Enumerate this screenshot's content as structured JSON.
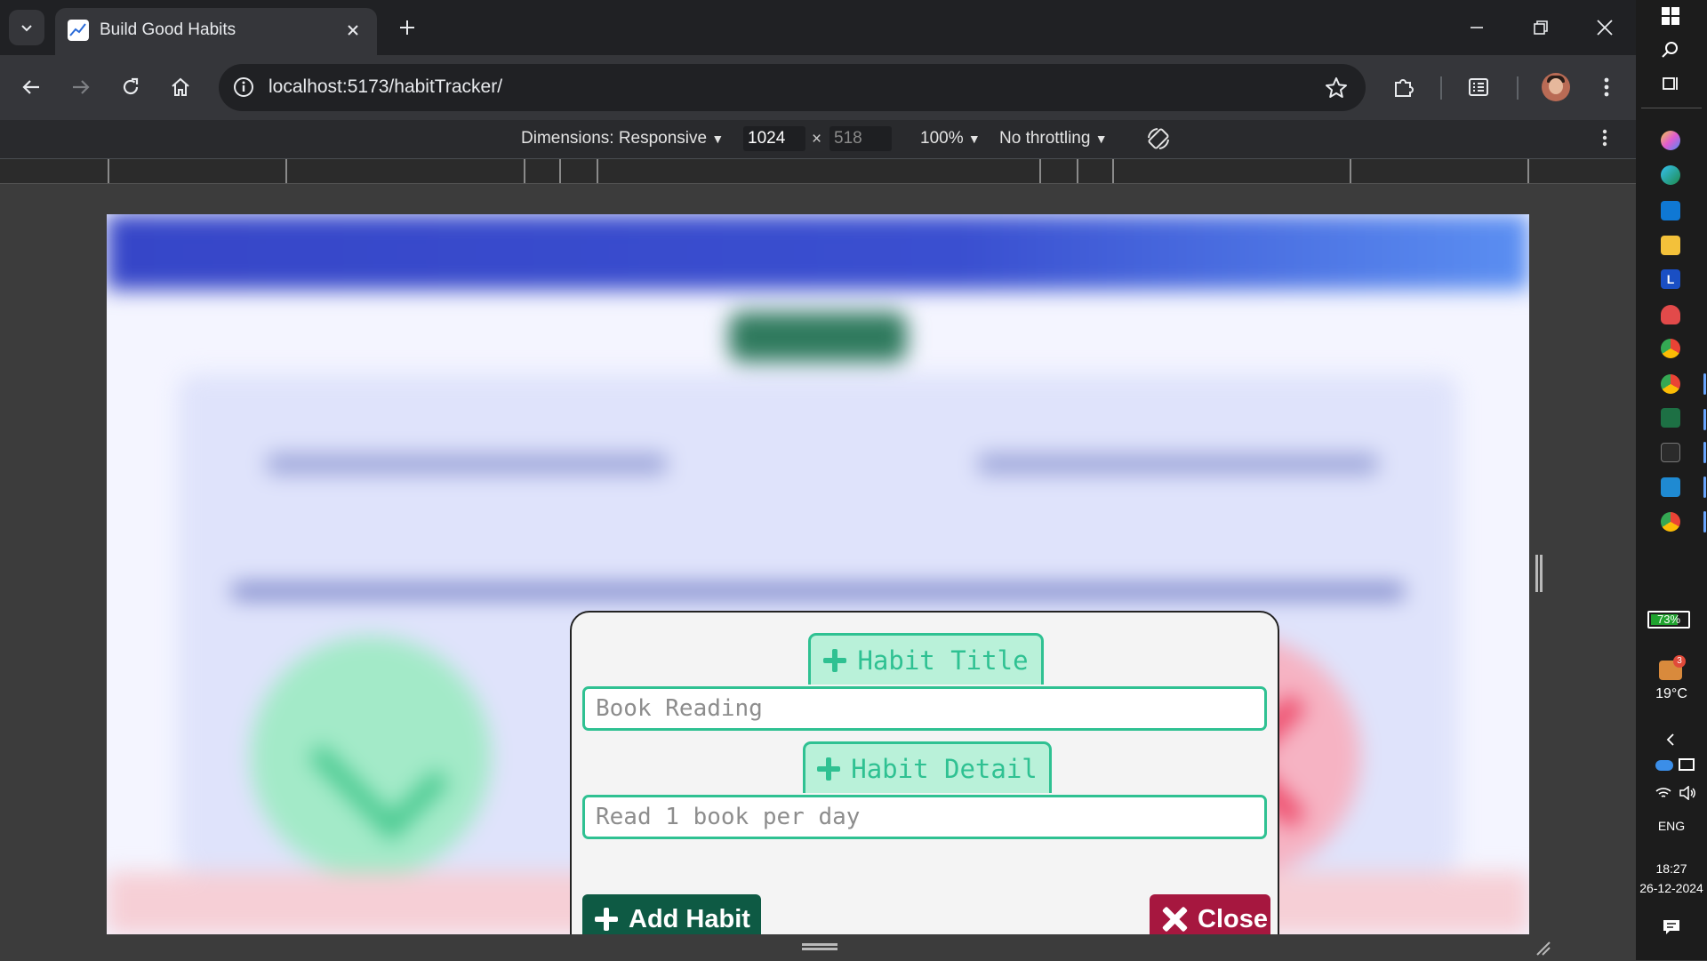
{
  "browser": {
    "tab_title": "Build Good Habits",
    "url": "localhost:5173/habitTracker/"
  },
  "devtools": {
    "dimensions_label": "Dimensions: Responsive",
    "width": "1024",
    "times": "×",
    "height": "518",
    "zoom": "100%",
    "throttling": "No throttling"
  },
  "modal": {
    "title_label": "Habit Title",
    "title_value": "Book Reading",
    "detail_label": "Habit Detail",
    "detail_value": "Read 1 book per day",
    "add_button": "Add Habit",
    "close_button": "Close",
    "accent_color": "#2fc192",
    "add_color": "#0e5a44",
    "close_color": "#a6173f"
  },
  "taskbar": {
    "battery": "73%",
    "notification_count": "3",
    "temperature": "19°C",
    "language": "ENG",
    "time": "18:27",
    "date": "26-12-2024"
  }
}
